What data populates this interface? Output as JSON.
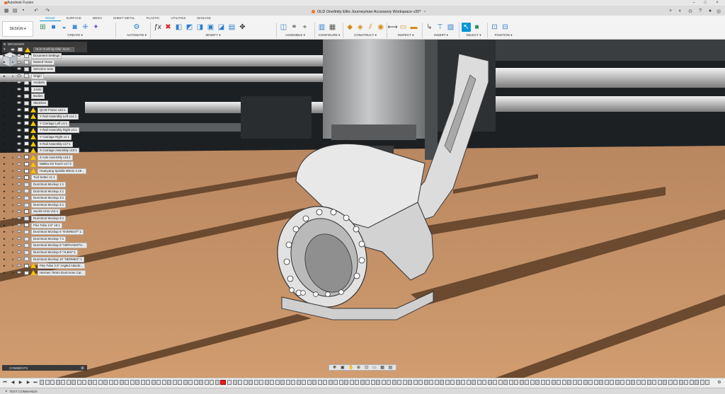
{
  "window": {
    "app_title": "Autodesk Fusion",
    "document_title": "OLD Onefinity Elite Journeyman Accessory Workspace v20*"
  },
  "workspace_tabs": [
    "SOLID",
    "SURFACE",
    "MESH",
    "SHEET METAL",
    "PLASTIC",
    "UTILITIES",
    "MANAGE"
  ],
  "active_tab": "SOLID",
  "design_button": "DESIGN",
  "toolbar_groups": [
    {
      "label": "CREATE",
      "icons": [
        "new-sketch-icon",
        "extrude-icon",
        "revolve-icon",
        "hole-icon",
        "pattern-icon",
        "form-icon"
      ]
    },
    {
      "label": "AUTOMATE",
      "icons": [
        "automate-icon"
      ]
    },
    {
      "label": "MODIFY",
      "icons": [
        "fx-icon",
        "delete-icon",
        "press-pull-icon",
        "fillet-icon",
        "chamfer-icon",
        "shell-icon",
        "combine-icon",
        "offset-icon",
        "move-icon"
      ]
    },
    {
      "label": "ASSEMBLE",
      "icons": [
        "new-component-icon",
        "joint-icon",
        "as-built-joint-icon"
      ]
    },
    {
      "label": "CONFIGURE",
      "icons": [
        "configure-icon",
        "table-icon"
      ]
    },
    {
      "label": "CONSTRUCT",
      "icons": [
        "offset-plane-icon",
        "plane-angle-icon",
        "axis-icon",
        "point-icon"
      ]
    },
    {
      "label": "INSPECT",
      "icons": [
        "measure-icon",
        "interference-icon",
        "section-icon"
      ]
    },
    {
      "label": "INSERT",
      "icons": [
        "insert-derive-icon",
        "insert-mesh-icon",
        "insert-svg-icon"
      ]
    },
    {
      "label": "SELECT",
      "icons": [
        "select-icon",
        "select-filter-icon"
      ]
    },
    {
      "label": "POSITION",
      "icons": [
        "capture-position-icon",
        "revert-icon"
      ]
    }
  ],
  "browser": {
    "title": "BROWSER",
    "root_label": "OLD Onefinity Elite Journ...",
    "items": [
      {
        "label": "Document Settings",
        "icon": "settings",
        "warn": false
      },
      {
        "label": "Named Views",
        "icon": "folder",
        "warn": false
      },
      {
        "label": "Selection Sets",
        "icon": "folder",
        "warn": false
      },
      {
        "label": "Origin",
        "icon": "folder",
        "warn": false
      },
      {
        "label": "Analysis",
        "icon": "folder",
        "warn": false
      },
      {
        "label": "Joints",
        "icon": "folder",
        "warn": false
      },
      {
        "label": "Bodies",
        "icon": "folder",
        "warn": false
      },
      {
        "label": "Sketches",
        "icon": "folder",
        "warn": false
      },
      {
        "label": "QCW Frame v22:1",
        "icon": "link",
        "warn": true
      },
      {
        "label": "Y Rail Assembly Left v14:1",
        "icon": "link",
        "warn": true
      },
      {
        "label": "Y Carriage Left v1:1",
        "icon": "link",
        "warn": true
      },
      {
        "label": "Y Rail Assembly Right v4:1",
        "icon": "link",
        "warn": true
      },
      {
        "label": "Y Carriage Right v1:1",
        "icon": "link",
        "warn": true
      },
      {
        "label": "X Rail Assembly v17:1",
        "icon": "link",
        "warn": true
      },
      {
        "label": "X Carriage Assembly v10:1",
        "icon": "link",
        "warn": true
      },
      {
        "label": "Z Axis Assembly v16:1",
        "icon": "link",
        "warn": true
      },
      {
        "label": "Makita G0 Touch v17:2",
        "icon": "link",
        "warn": true
      },
      {
        "label": "Huanyang Spindle 80mm 2.2K...",
        "icon": "link",
        "warn": true
      },
      {
        "label": "Tool Setter v1:1",
        "icon": "link",
        "warn": false
      },
      {
        "label": "Dust Boot Mockup 1:1",
        "icon": "comp",
        "warn": false
      },
      {
        "label": "Dust Boot Mockup 2:1",
        "icon": "comp",
        "warn": false
      },
      {
        "label": "Dust Boot Mockup 3:1",
        "icon": "comp",
        "warn": false
      },
      {
        "label": "Dust Boot Mockup 4:1",
        "icon": "comp",
        "warn": false
      },
      {
        "label": "Suckit Arms v12:1",
        "icon": "link",
        "warn": false
      },
      {
        "label": "Dust Boot Mockup 5:1",
        "icon": "comp",
        "warn": false
      },
      {
        "label": "Flex Tube 2.5\" v5:1",
        "icon": "link",
        "warn": false
      },
      {
        "label": "Dust Boot Mockup 6 \"EVEREST\":1",
        "icon": "comp",
        "warn": false
      },
      {
        "label": "Dust Boot Mockup 7:1",
        "icon": "comp",
        "warn": false
      },
      {
        "label": "Dust Boot Mockup 8 \"HEPHAESTU...",
        "icon": "comp",
        "warn": false
      },
      {
        "label": "Dust Boot Mockup 9 \"ALBIS\":1",
        "icon": "comp",
        "warn": false
      },
      {
        "label": "Dust Boot Mockup 10 \"HERMES\":1",
        "icon": "comp",
        "warn": false
      },
      {
        "label": "Flex Tube 2.5\" Angled Attachr...",
        "icon": "link",
        "warn": true
      },
      {
        "label": "Hermes 75mm Dust Hose Car...",
        "icon": "link",
        "warn": true
      }
    ]
  },
  "comments_label": "COMMENTS",
  "text_commands_label": "TEXT COMMANDS",
  "colors": {
    "accent": "#0696d7",
    "spoilboard": "#c8956a",
    "part": "#e6e6e6",
    "warning": "#f2c500"
  }
}
